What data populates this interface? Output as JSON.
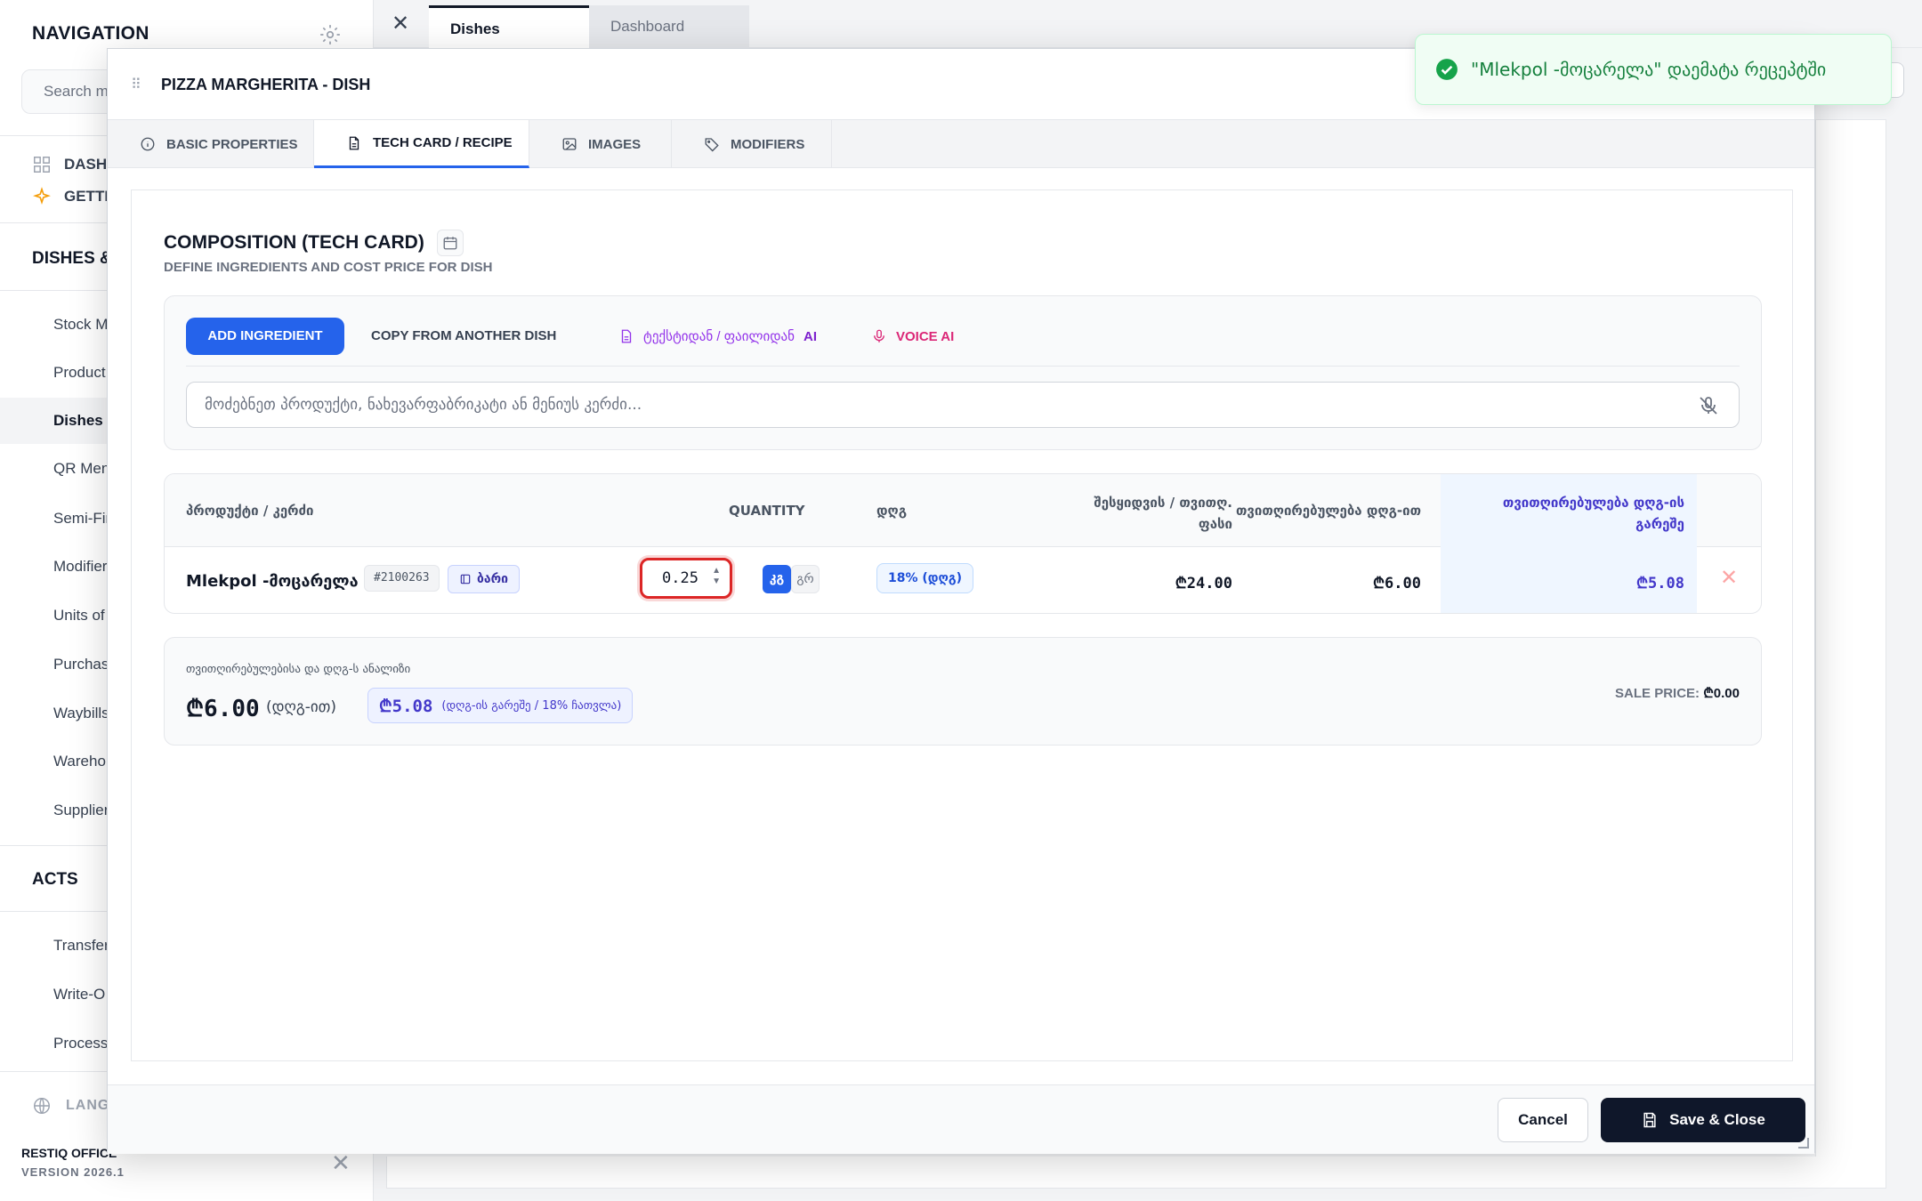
{
  "sidebar": {
    "title": "NAVIGATION",
    "search_placeholder": "Search m",
    "quick": [
      {
        "label": "DASH"
      },
      {
        "label": "GETTI"
      }
    ],
    "section_dishes": "DISHES &",
    "items": [
      {
        "label": "Stock M"
      },
      {
        "label": "Product"
      },
      {
        "label": "Dishes"
      },
      {
        "label": "QR Men"
      },
      {
        "label": "Semi-Fir"
      },
      {
        "label": "Modifier"
      },
      {
        "label": "Units of"
      },
      {
        "label": "Purchas"
      },
      {
        "label": "Waybills"
      },
      {
        "label": "Wareho"
      },
      {
        "label": "Supplier"
      }
    ],
    "section_acts": "ACTS",
    "acts": [
      {
        "label": "Transfer"
      },
      {
        "label": "Write-O"
      },
      {
        "label": "Processi"
      }
    ],
    "language": "LANGU",
    "brand": "RESTIQ OFFICE",
    "version": "VERSION 2026.1"
  },
  "topbar": {
    "close": "✕",
    "tabs": [
      {
        "label": "Dishes"
      },
      {
        "label": "Dashboard"
      }
    ]
  },
  "modal": {
    "drag": "⠿",
    "title": "PIZZA MARGHERITA - DISH",
    "tabs": [
      {
        "label": "BASIC PROPERTIES"
      },
      {
        "label": "TECH CARD / RECIPE"
      },
      {
        "label": "IMAGES"
      },
      {
        "label": "MODIFIERS"
      }
    ],
    "composition": {
      "title": "COMPOSITION (TECH CARD)",
      "subtitle": "DEFINE INGREDIENTS AND COST PRICE FOR DISH"
    },
    "toolbar": {
      "add": "ADD INGREDIENT",
      "copy": "COPY FROM ANOTHER DISH",
      "ai_text": "ტექსტიდან / ფაილიდან",
      "ai_suffix": "AI",
      "voice": "VOICE AI",
      "search_placeholder": "მოძებნეთ პროდუქტი, ნახევარფაბრიკატი ან მენიუს კერძი..."
    },
    "table": {
      "headers": {
        "product": "პროდუქტი / კერძი",
        "quantity": "QUANTITY",
        "vat": "დღგ",
        "purchase_line1": "შესყიდვის / თვითღ.",
        "purchase_line2": "ფასი",
        "cost_with_vat": "თვითღირებულება დღგ-ით",
        "cost_no_vat_line1": "თვითღირებულება დღგ-ის",
        "cost_no_vat_line2": "გარეშე"
      },
      "rows": [
        {
          "product": "Mlekpol -მოცარელა",
          "code": "#2100263",
          "store": "ბარი",
          "quantity": "0.25",
          "unit_active": "კგ",
          "unit_alt": "გრ",
          "vat": "18% (დღგ)",
          "purchase_price": "₾24.00",
          "cost_with_vat": "₾6.00",
          "cost_no_vat": "₾5.08",
          "delete": "✕"
        }
      ]
    },
    "summary": {
      "label": "თვითღირებულებისა და დღგ-ს ანალიზი",
      "total": "₾6.00",
      "total_note": "(დღგ-ით)",
      "net": "₾5.08",
      "net_note": "(დღგ-ის გარეშე / 18% ჩათვლა)",
      "sale_label": "SALE PRICE:",
      "sale_value": "₾0.00"
    },
    "footer": {
      "cancel": "Cancel",
      "save": "Save & Close"
    }
  },
  "toast": {
    "message": "\"Mlekpol -მოცარელა\" დაემატა რეცეპტში"
  },
  "colors": {
    "accent": "#2563eb",
    "success": "#15803d",
    "danger": "#dc2626",
    "dark": "#0f172a"
  }
}
